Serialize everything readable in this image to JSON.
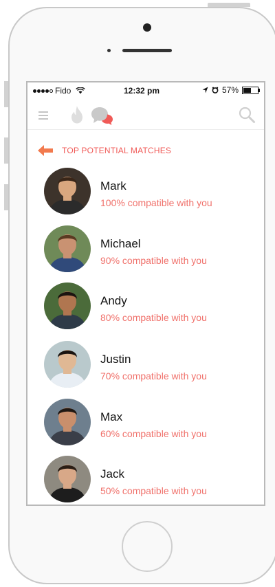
{
  "status_bar": {
    "carrier": "Fido",
    "time": "12:32 pm",
    "battery_percent": "57%",
    "battery_level": 0.57
  },
  "header": {
    "icons": [
      "hamburger-menu-icon",
      "flame-icon",
      "chat-bubbles-icon",
      "search-icon"
    ]
  },
  "section": {
    "title": "TOP POTENTIAL MATCHES"
  },
  "matches": [
    {
      "name": "Mark",
      "compatibility": "100% compatible with you",
      "skin": "#d9a77f",
      "hair": "#3a2618",
      "shirt": "#2b2b2b",
      "bg": "#3d332b"
    },
    {
      "name": "Michael",
      "compatibility": "90% compatible with you",
      "skin": "#c99272",
      "hair": "#5a3a22",
      "shirt": "#304a7a",
      "bg": "#6f8a58"
    },
    {
      "name": "Andy",
      "compatibility": "80% compatible with you",
      "skin": "#b07650",
      "hair": "#1c1410",
      "shirt": "#2e3b48",
      "bg": "#4b6b3a"
    },
    {
      "name": "Justin",
      "compatibility": "70% compatible with you",
      "skin": "#e0b894",
      "hair": "#1a1410",
      "shirt": "#e8eef4",
      "bg": "#b9c9cc"
    },
    {
      "name": "Max",
      "compatibility": "60% compatible with you",
      "skin": "#c98f6c",
      "hair": "#1f1712",
      "shirt": "#3a3e48",
      "bg": "#6e7f8e"
    },
    {
      "name": "Jack",
      "compatibility": "50% compatible with you",
      "skin": "#d8a888",
      "hair": "#2a1d14",
      "shirt": "#1d1d1d",
      "bg": "#8e8a80"
    }
  ]
}
